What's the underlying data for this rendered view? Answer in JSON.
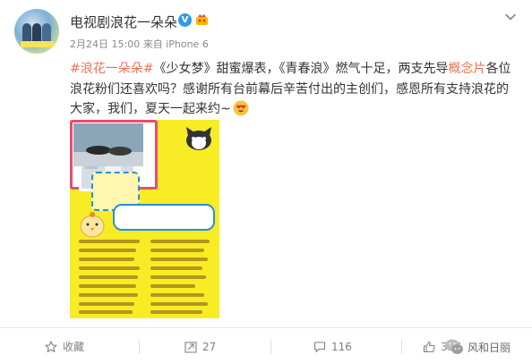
{
  "author": {
    "name": "电视剧浪花一朵朵",
    "verified_badge": "V"
  },
  "meta": {
    "date": "2月24日 15:00",
    "source": "来自 iPhone 6"
  },
  "post": {
    "hashtag": "#浪花一朵朵#",
    "text_1": "《少女梦》甜蜜爆表，《青春浪》燃气十足，两支先导",
    "link_text": "概念片",
    "text_2": "各位浪花粉们还喜欢吗？感谢所有台前幕后辛苦付出的主创们，感恩所有支持浪花的大家，我们，夏天一起来约~"
  },
  "actions": {
    "favorite_label": "收藏",
    "repost_count": "27",
    "comment_count": "116",
    "like_count": "327"
  },
  "watermark": {
    "text": "风和日丽"
  },
  "colors": {
    "link": "#eb7350",
    "poster_bg": "#f8ec25",
    "verified": "#2e9be6"
  }
}
